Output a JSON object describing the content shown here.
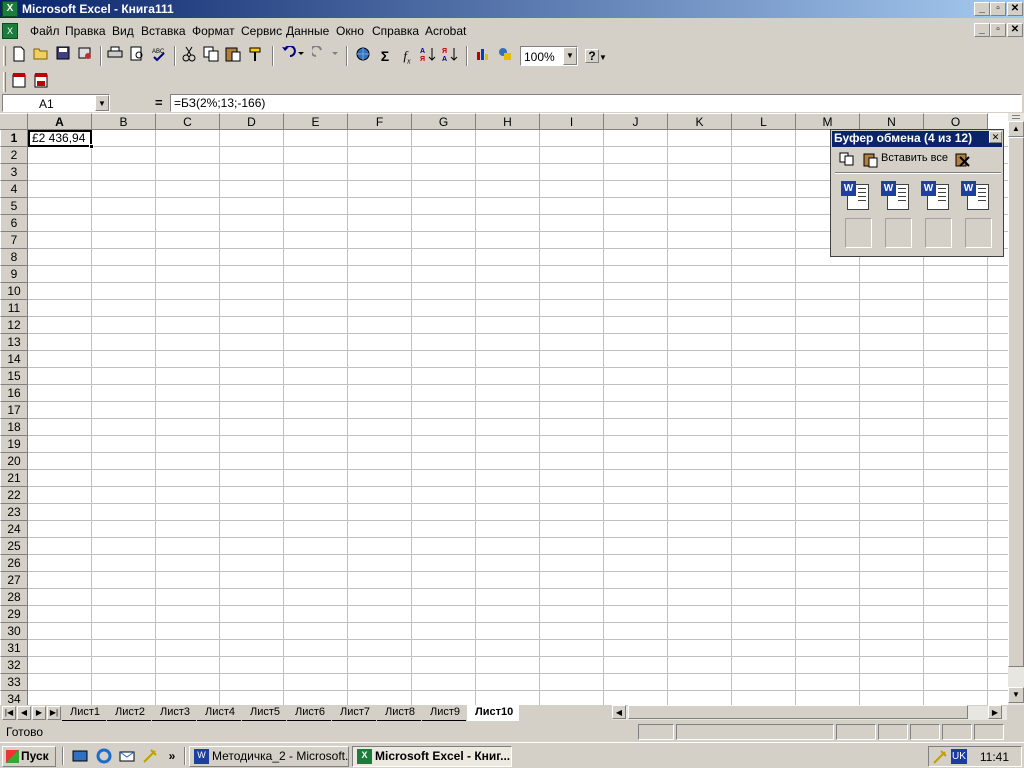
{
  "window": {
    "title": "Microsoft Excel - Книга111",
    "app_icon": "X",
    "buttons": [
      "_",
      "▫",
      "✕"
    ]
  },
  "menu": {
    "doc_icon": "X",
    "items": [
      "Файл",
      "Правка",
      "Вид",
      "Вставка",
      "Формат",
      "Сервис",
      "Данные",
      "Окно",
      "Справка",
      "Acrobat"
    ],
    "doc_buttons": [
      "_",
      "▫",
      "✕"
    ]
  },
  "toolbar": {
    "zoom": "100%",
    "icons": [
      "new-icon",
      "open-icon",
      "save-icon",
      "permissions-icon",
      "print-icon",
      "print-preview-icon",
      "spelling-icon",
      "cut-icon",
      "copy-icon",
      "paste-icon",
      "format-painter-icon",
      "undo-icon",
      "redo-icon",
      "hyperlink-icon",
      "autosum-icon",
      "function-icon",
      "sort-asc-icon",
      "sort-desc-icon",
      "chart-wizard-icon",
      "drawing-icon"
    ],
    "help": "?"
  },
  "acrobat_toolbar": {
    "icons": [
      "convert-to-pdf-icon",
      "convert-and-email-pdf-icon"
    ]
  },
  "formula_bar": {
    "name_box": "A1",
    "equals": "=",
    "formula": "=БЗ(2%;13;-166)"
  },
  "sheet": {
    "columns": [
      "A",
      "B",
      "C",
      "D",
      "E",
      "F",
      "G",
      "H",
      "I",
      "J",
      "K",
      "L",
      "M",
      "N",
      "O"
    ],
    "rows": [
      "1",
      "2",
      "3",
      "4",
      "5",
      "6",
      "7",
      "8",
      "9",
      "10",
      "11",
      "12",
      "13",
      "14",
      "15",
      "16",
      "17",
      "18",
      "19",
      "20",
      "21",
      "22",
      "23",
      "24",
      "25",
      "26",
      "27",
      "28",
      "29",
      "30",
      "31",
      "32",
      "33",
      "34"
    ],
    "active_cell_value": "£2 436,94"
  },
  "tabs": [
    "Лист1",
    "Лист2",
    "Лист3",
    "Лист4",
    "Лист5",
    "Лист6",
    "Лист7",
    "Лист8",
    "Лист9",
    "Лист10"
  ],
  "active_tab": "Лист10",
  "status": {
    "text": "Готово"
  },
  "clipboard": {
    "title": "Буфер обмена (4 из 12)",
    "paste_all": "Вставить все",
    "close": "✕",
    "items": [
      "word-clip-icon",
      "word-clip-icon",
      "word-clip-icon",
      "word-clip-icon"
    ],
    "item_letter": "W"
  },
  "taskbar": {
    "start": "Пуск",
    "tasks": [
      {
        "label": "Методичка_2 - Microsoft...",
        "icon": "W"
      },
      {
        "label": "Microsoft Excel - Книг...",
        "icon": "X"
      }
    ],
    "lang": "UK",
    "clock": "11:41",
    "quick_launch_more": "»"
  }
}
